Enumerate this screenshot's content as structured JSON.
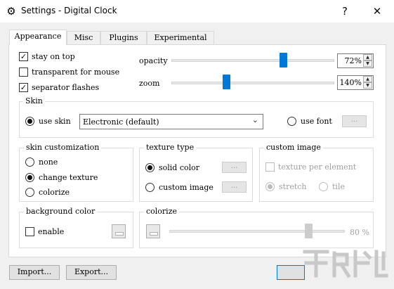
{
  "window": {
    "title": "Settings - Digital Clock",
    "help_button": "?",
    "close_button": "✕",
    "app_icon": "gear-icon"
  },
  "tabs": [
    {
      "label": "Appearance",
      "active": true
    },
    {
      "label": "Misc",
      "active": false
    },
    {
      "label": "Plugins",
      "active": false
    },
    {
      "label": "Experimental",
      "active": false
    }
  ],
  "appearance": {
    "stay_on_top": {
      "label": "stay on top",
      "checked": true
    },
    "transparent_for_mouse": {
      "label": "transparent for mouse",
      "checked": false
    },
    "separator_flashes": {
      "label": "separator flashes",
      "checked": true
    },
    "opacity": {
      "label": "opacity",
      "value_text": "72%",
      "value": 0.72
    },
    "zoom": {
      "label": "zoom",
      "value_text": "140%",
      "value": 1.4
    }
  },
  "skin": {
    "title": "Skin",
    "use_skin_label": "use skin",
    "use_skin_selected": true,
    "selected_skin": "Electronic (default)",
    "use_font_label": "use font",
    "use_font_selected": false,
    "font_button": "..."
  },
  "skin_customization": {
    "title": "skin customization",
    "options": [
      {
        "label": "none",
        "selected": false
      },
      {
        "label": "change texture",
        "selected": true
      },
      {
        "label": "colorize",
        "selected": false
      }
    ]
  },
  "texture_type": {
    "title": "texture type",
    "solid_color": {
      "label": "solid color",
      "selected": true,
      "button": "..."
    },
    "custom_image": {
      "label": "custom image",
      "selected": false,
      "button": "..."
    }
  },
  "custom_image": {
    "title": "custom image",
    "texture_per_element": {
      "label": "texture per element",
      "checked": false
    },
    "stretch": {
      "label": "stretch",
      "selected": true
    },
    "tile": {
      "label": "tile",
      "selected": false
    }
  },
  "background_color": {
    "title": "background color",
    "enable": {
      "label": "enable",
      "checked": false
    }
  },
  "colorize": {
    "title": "colorize",
    "value_text": "80 %",
    "value": 0.8
  },
  "footer": {
    "import_button": "Import...",
    "export_button": "Export..."
  },
  "colors": {
    "accent": "#0078d7",
    "background": "#f0f0f0",
    "panel": "#ffffff"
  }
}
